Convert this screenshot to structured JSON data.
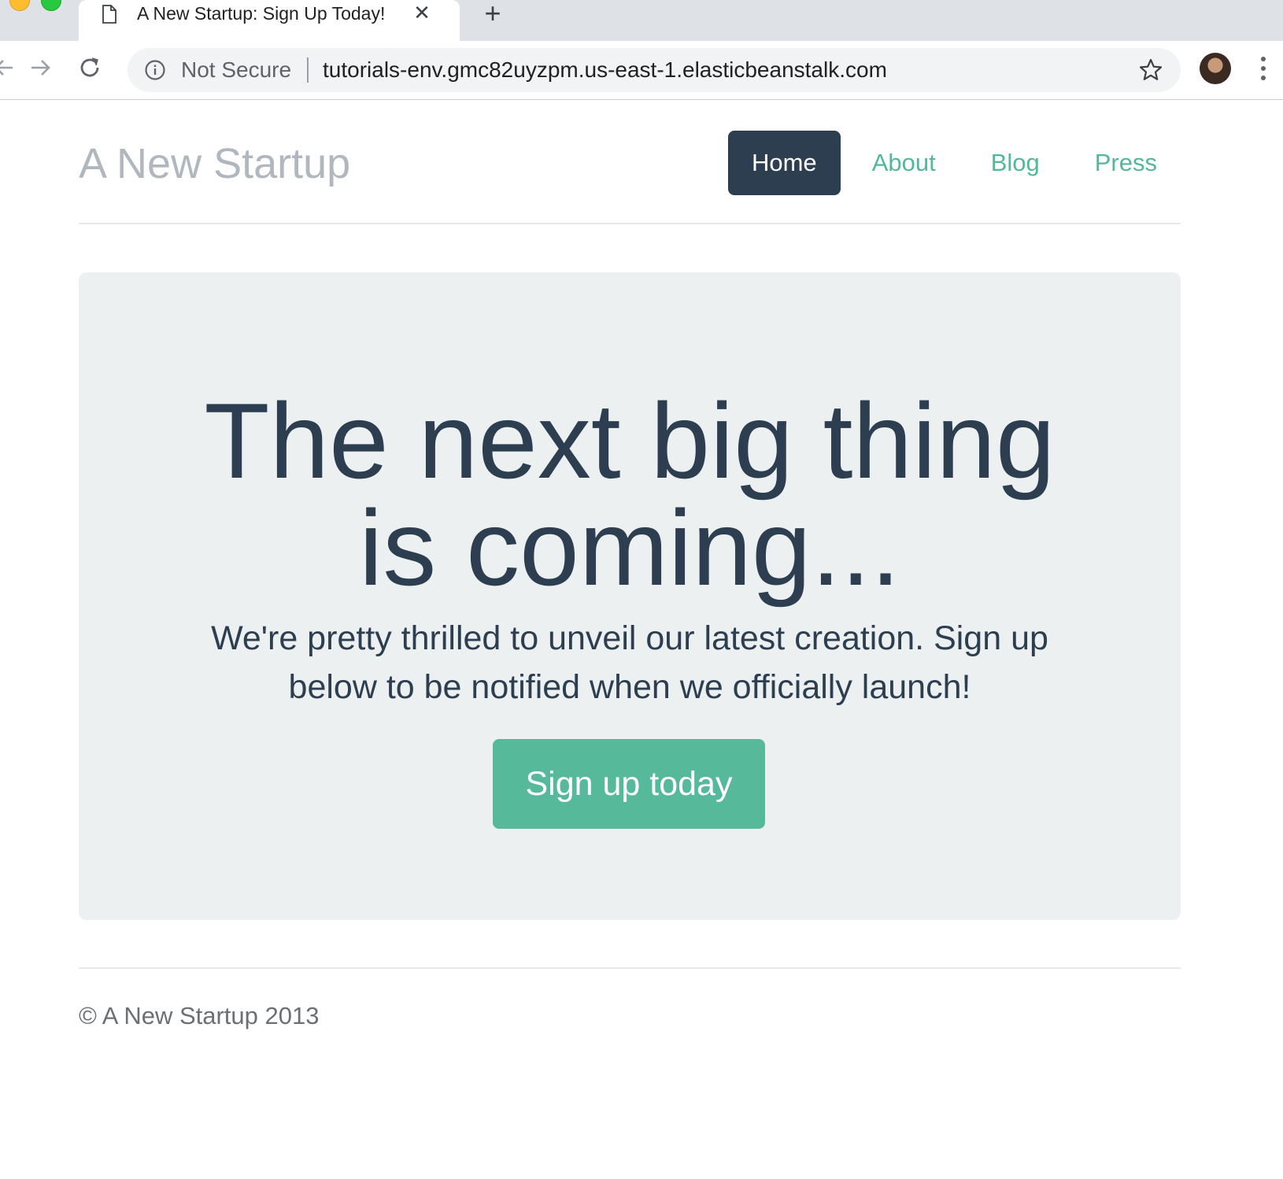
{
  "browser": {
    "tab_title": "A New Startup: Sign Up Today!",
    "tab_close": "✕",
    "new_tab": "+",
    "security_label": "Not Secure",
    "url": "tutorials-env.gmc82uyzpm.us-east-1.elasticbeanstalk.com"
  },
  "site": {
    "brand": "A New Startup",
    "nav": [
      {
        "label": "Home",
        "active": true
      },
      {
        "label": "About",
        "active": false
      },
      {
        "label": "Blog",
        "active": false
      },
      {
        "label": "Press",
        "active": false
      }
    ]
  },
  "hero": {
    "title_line1": "The next big thing",
    "title_line2": "is coming...",
    "lead": "We're pretty thrilled to unveil our latest creation. Sign up below to be notified when we officially launch!",
    "cta_label": "Sign up today"
  },
  "footer": {
    "text": "© A New Startup 2013"
  },
  "colors": {
    "navy": "#2d3e50",
    "green": "#55b99a",
    "hero_bg": "#ecf0f1",
    "brand_gray": "#b0b7bf"
  }
}
